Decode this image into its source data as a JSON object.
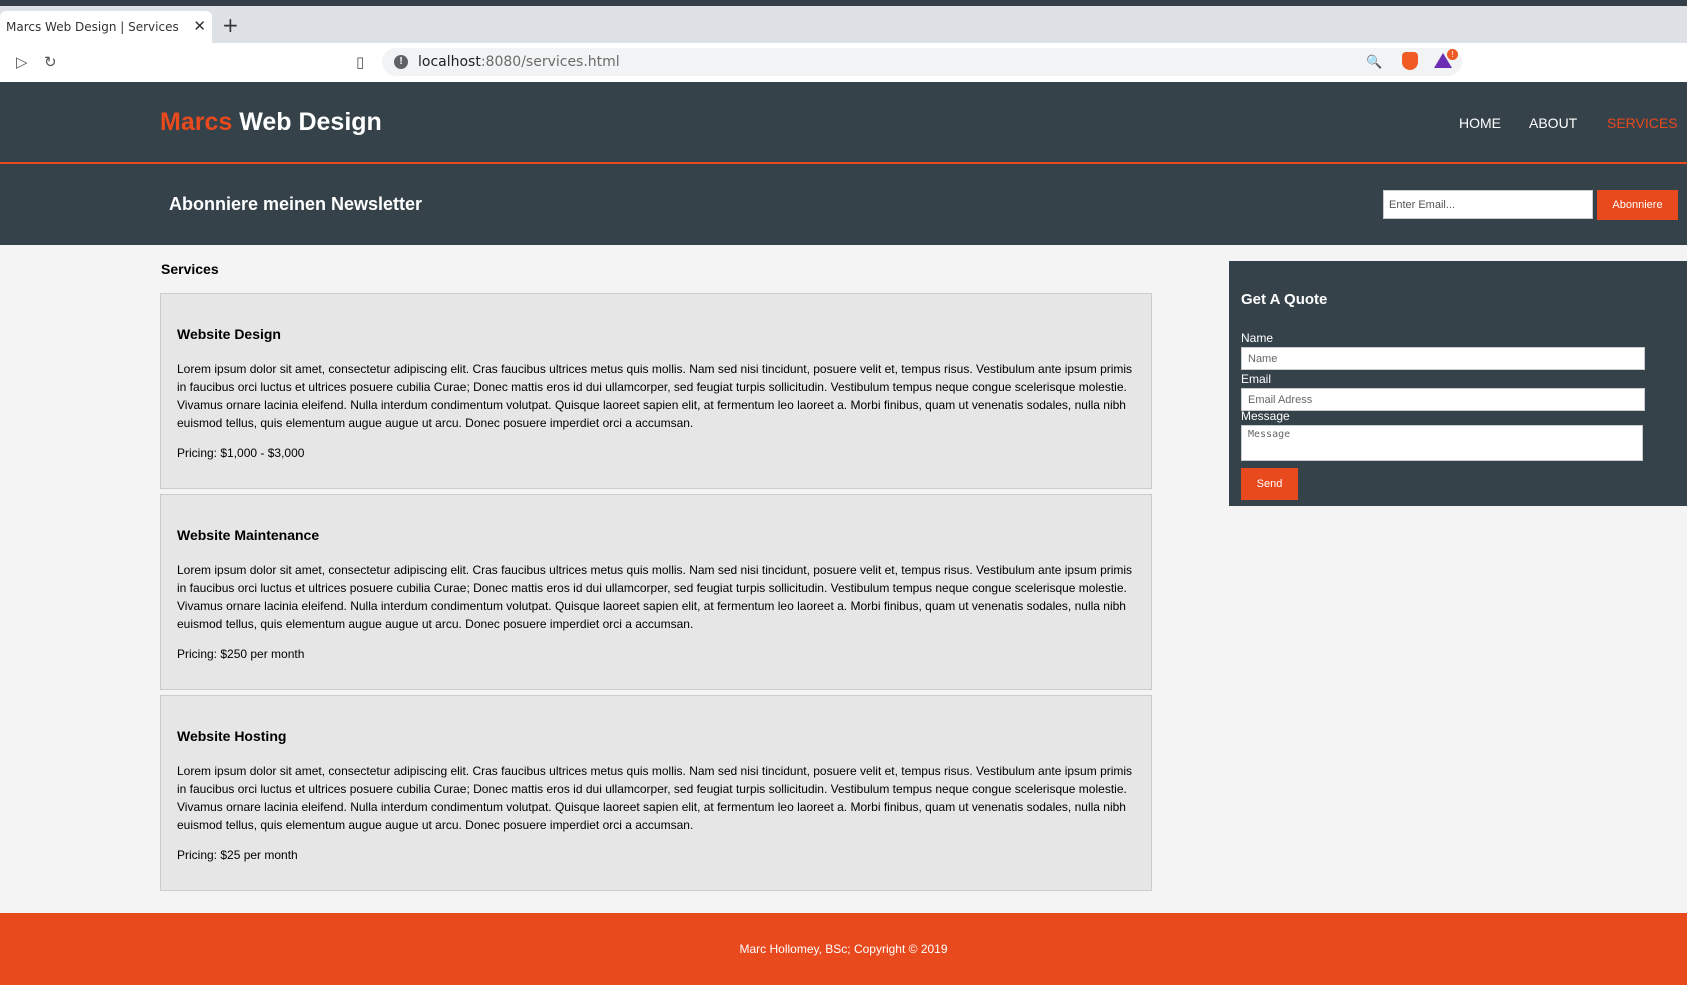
{
  "browser": {
    "tab_title": "Marcs Web Design | Services",
    "tab_close": "✕",
    "new_tab": "+",
    "url_host": "localhost",
    "url_rest": ":8080/services.html",
    "rewards_count": "!"
  },
  "header": {
    "logo_highlight": "Marcs",
    "logo_rest": " Web Design",
    "nav": {
      "home": "HOME",
      "about": "ABOUT",
      "services": "SERVICES"
    }
  },
  "newsletter": {
    "title": "Abonniere meinen Newsletter",
    "email_placeholder": "Enter Email...",
    "button": "Abonniere"
  },
  "main": {
    "title": "Services",
    "services": [
      {
        "title": "Website Design",
        "text": "Lorem ipsum dolor sit amet, consectetur adipiscing elit. Cras faucibus ultrices metus quis mollis. Nam sed nisi tincidunt, posuere velit et, tempus risus. Vestibulum ante ipsum primis in faucibus orci luctus et ultrices posuere cubilia Curae; Donec mattis eros id dui ullamcorper, sed feugiat turpis sollicitudin. Vestibulum tempus neque congue scelerisque molestie. Vivamus ornare lacinia eleifend. Nulla interdum condimentum volutpat. Quisque laoreet sapien elit, at fermentum leo laoreet a. Morbi finibus, quam ut venenatis sodales, nulla nibh euismod tellus, quis elementum augue augue ut arcu. Donec posuere imperdiet orci a accumsan.",
        "pricing": "Pricing: $1,000 - $3,000"
      },
      {
        "title": "Website Maintenance",
        "text": "Lorem ipsum dolor sit amet, consectetur adipiscing elit. Cras faucibus ultrices metus quis mollis. Nam sed nisi tincidunt, posuere velit et, tempus risus. Vestibulum ante ipsum primis in faucibus orci luctus et ultrices posuere cubilia Curae; Donec mattis eros id dui ullamcorper, sed feugiat turpis sollicitudin. Vestibulum tempus neque congue scelerisque molestie. Vivamus ornare lacinia eleifend. Nulla interdum condimentum volutpat. Quisque laoreet sapien elit, at fermentum leo laoreet a. Morbi finibus, quam ut venenatis sodales, nulla nibh euismod tellus, quis elementum augue augue ut arcu. Donec posuere imperdiet orci a accumsan.",
        "pricing": "Pricing: $250 per month"
      },
      {
        "title": "Website Hosting",
        "text": "Lorem ipsum dolor sit amet, consectetur adipiscing elit. Cras faucibus ultrices metus quis mollis. Nam sed nisi tincidunt, posuere velit et, tempus risus. Vestibulum ante ipsum primis in faucibus orci luctus et ultrices posuere cubilia Curae; Donec mattis eros id dui ullamcorper, sed feugiat turpis sollicitudin. Vestibulum tempus neque congue scelerisque molestie. Vivamus ornare lacinia eleifend. Nulla interdum condimentum volutpat. Quisque laoreet sapien elit, at fermentum leo laoreet a. Morbi finibus, quam ut venenatis sodales, nulla nibh euismod tellus, quis elementum augue augue ut arcu. Donec posuere imperdiet orci a accumsan.",
        "pricing": "Pricing: $25 per month"
      }
    ]
  },
  "quote": {
    "title": "Get A Quote",
    "name_label": "Name",
    "name_placeholder": "Name",
    "email_label": "Email",
    "email_placeholder": "Email Adress",
    "message_label": "Message",
    "message_placeholder": "Message",
    "send": "Send"
  },
  "footer": {
    "text": "Marc Hollomey, BSc; Copyright © 2019"
  },
  "colors": {
    "accent": "#e8491d",
    "dark": "#35424a",
    "card": "#e6e6e6",
    "background": "#f4f4f4"
  },
  "icons": [
    "close-icon",
    "plus-icon",
    "play-icon",
    "reload-icon",
    "bookmark-icon",
    "info-icon",
    "zoom-icon",
    "brave-icon",
    "rewards-icon"
  ]
}
